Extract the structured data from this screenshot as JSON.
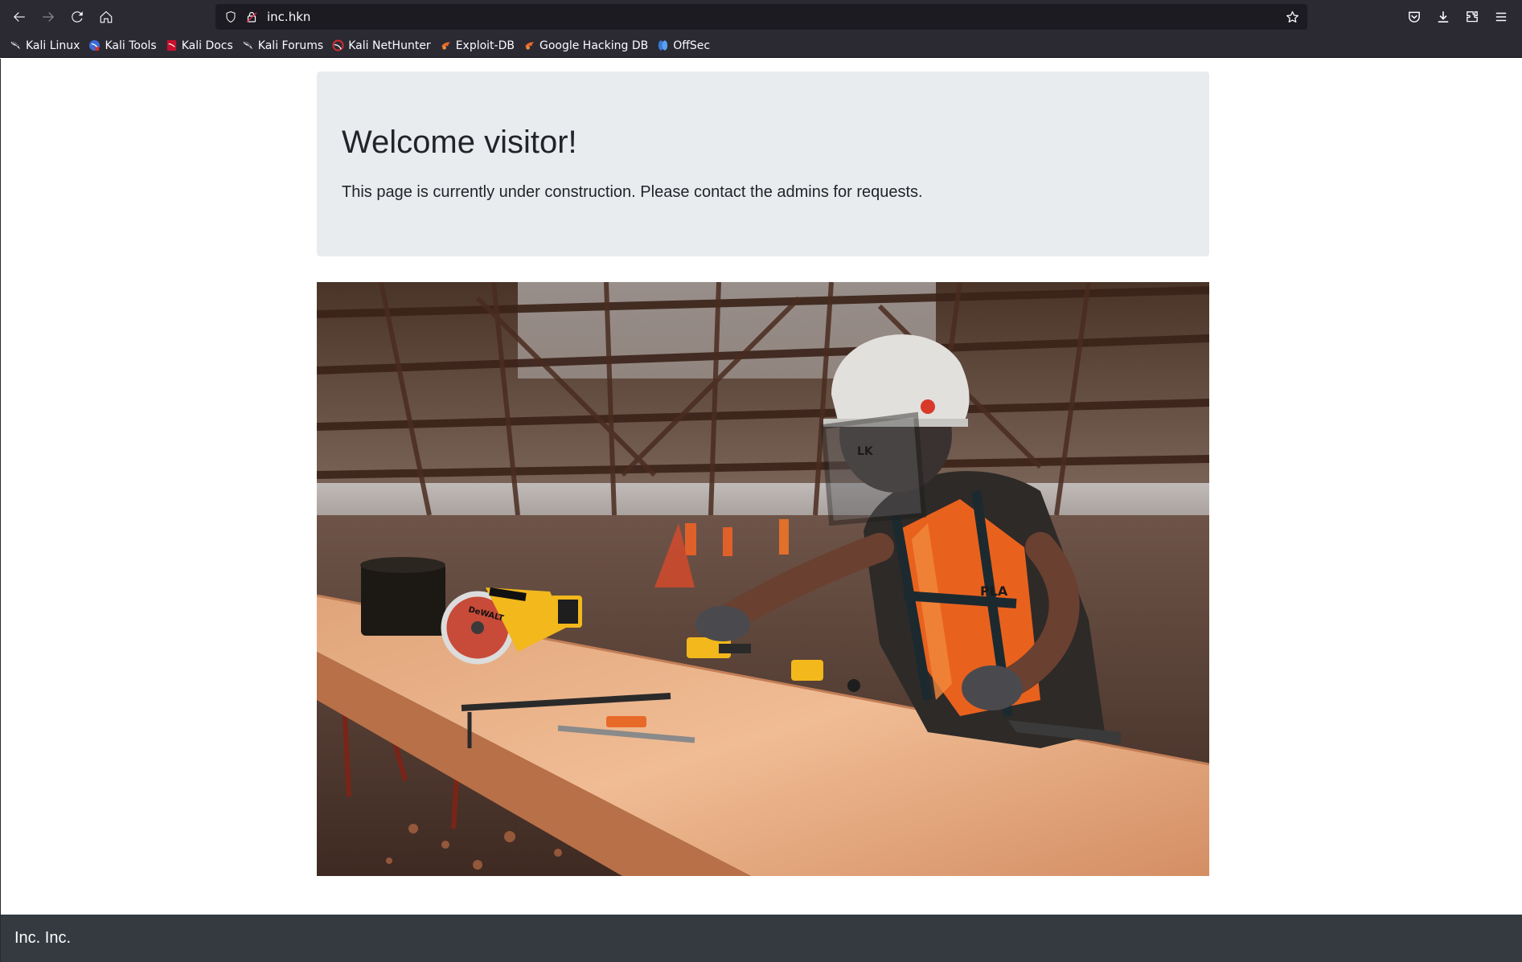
{
  "browser": {
    "url": "inc.hkn",
    "bookmarks": [
      {
        "label": "Kali Linux",
        "icon": "kali-dragon-icon",
        "color": "#1a1a1a"
      },
      {
        "label": "Kali Tools",
        "icon": "kali-tools-icon",
        "color": "#3d6bd8"
      },
      {
        "label": "Kali Docs",
        "icon": "kali-docs-icon",
        "color": "#c8102e"
      },
      {
        "label": "Kali Forums",
        "icon": "kali-dragon-icon",
        "color": "#1a1a1a"
      },
      {
        "label": "Kali NetHunter",
        "icon": "nethunter-icon",
        "color": "#d32f2f"
      },
      {
        "label": "Exploit-DB",
        "icon": "exploit-db-icon",
        "color": "#e8692a"
      },
      {
        "label": "Google Hacking DB",
        "icon": "ghdb-icon",
        "color": "#e8692a"
      },
      {
        "label": "OffSec",
        "icon": "offsec-icon",
        "color": "#3a7bd5"
      }
    ]
  },
  "jumbotron": {
    "title": "Welcome visitor!",
    "lead": "This page is currently under construction. Please contact the admins for requests."
  },
  "hero_image": {
    "description_icon": "construction-worker-photo",
    "helmet_text": "LK",
    "vest_text": "PLA",
    "saw_brand": "DeWALT"
  },
  "footer": {
    "text": "Inc. Inc."
  },
  "colors": {
    "jumbotron_bg": "#e9ecef",
    "footer_bg": "#343a40",
    "browser_chrome": "#2b2a33"
  }
}
